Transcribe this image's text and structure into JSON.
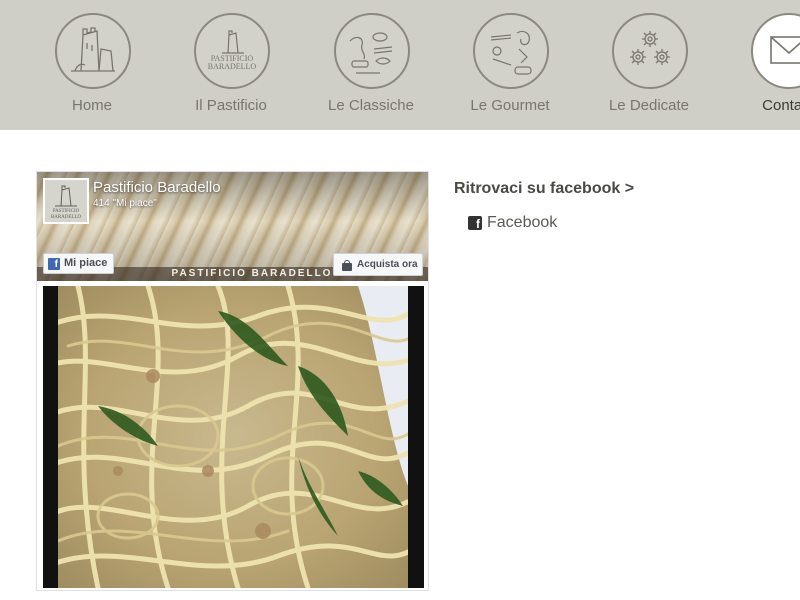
{
  "nav": {
    "items": [
      {
        "label": "Home",
        "icon": "tower-icon"
      },
      {
        "label": "Il Pastificio",
        "icon": "pastificio-logo-icon"
      },
      {
        "label": "Le Classiche",
        "icon": "pasta-shapes-icon"
      },
      {
        "label": "Le Gourmet",
        "icon": "gourmet-pasta-icon"
      },
      {
        "label": "Le Dedicate",
        "icon": "gears-icon"
      },
      {
        "label": "Contatti",
        "icon": "envelope-icon"
      }
    ],
    "logo_text_line1": "PASTIFICIO",
    "logo_text_line2": "BARADELLO"
  },
  "fb_widget": {
    "page_name": "Pastificio Baradello",
    "likes_count": "414 \"Mi piace\"",
    "like_button": "Mi piace",
    "shop_button": "Acquista ora",
    "cover_text": "PASTIFICIO BARADELLO",
    "avatar_text_line1": "PASTIFICIO",
    "avatar_text_line2": "BARADELLO"
  },
  "sidebar": {
    "heading": "Ritrovaci su facebook >",
    "link_label": "Facebook"
  },
  "colors": {
    "nav_bg": "#d0cfc7",
    "nav_text": "#77756d",
    "heading_text": "#4a4945",
    "fb_blue": "#4267b2"
  }
}
